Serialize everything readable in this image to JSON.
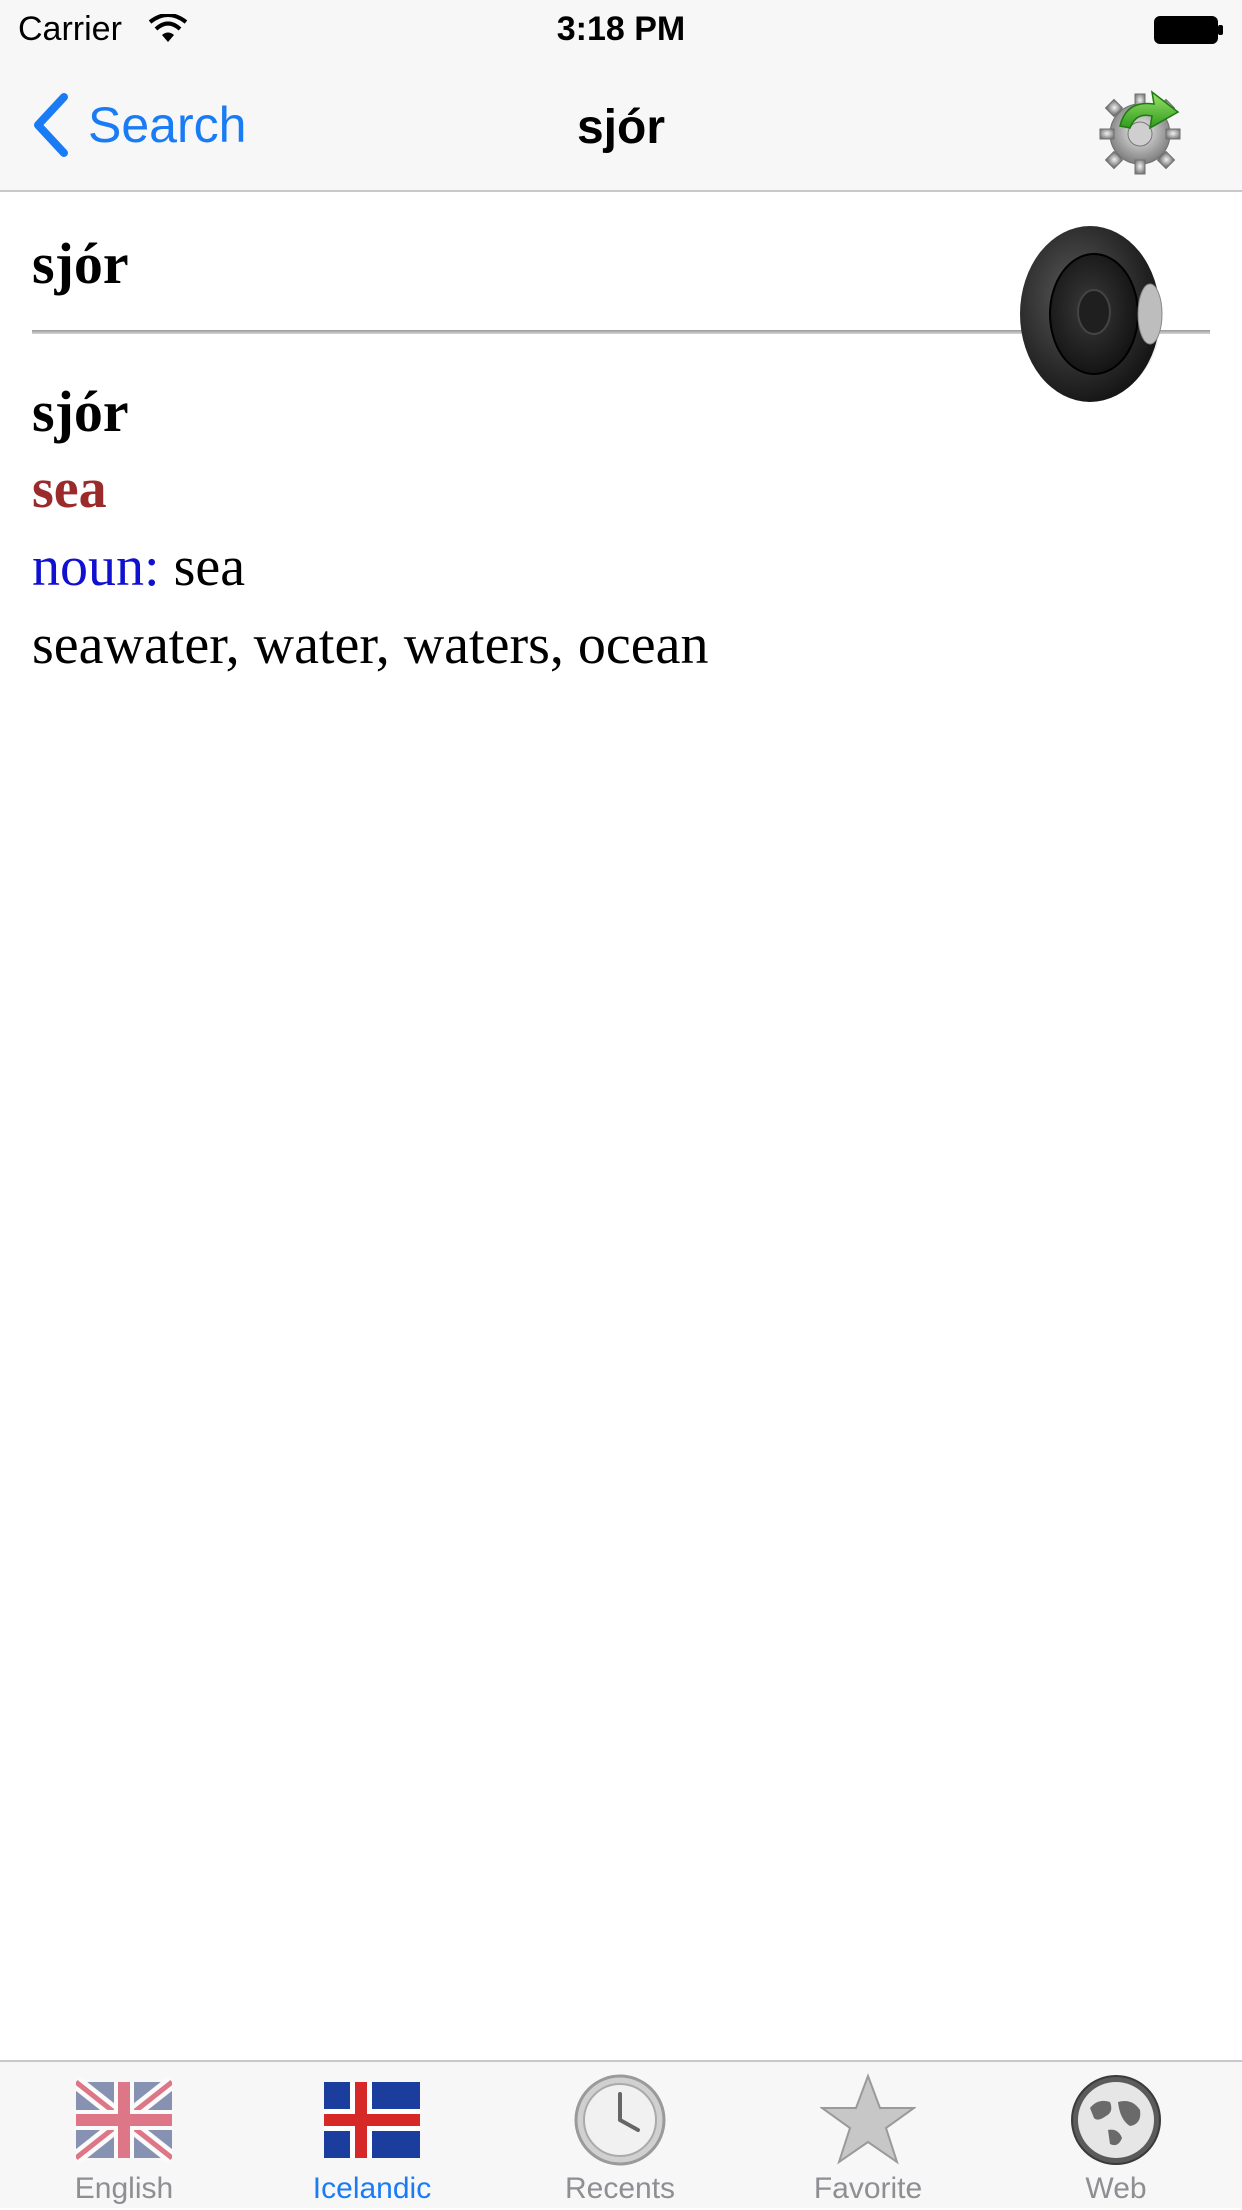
{
  "status_bar": {
    "carrier": "Carrier",
    "time": "3:18 PM"
  },
  "nav": {
    "back_label": "Search",
    "title": "sjór"
  },
  "entry": {
    "header_word": "sjór",
    "word": "sjór",
    "translation": "sea",
    "pos_label": "noun:",
    "pos_value": " sea",
    "synonyms": "seawater, water, waters, ocean"
  },
  "tabs": [
    {
      "label": "English",
      "icon": "uk-flag-icon",
      "active": false
    },
    {
      "label": "Icelandic",
      "icon": "iceland-flag-icon",
      "active": true
    },
    {
      "label": "Recents",
      "icon": "clock-icon",
      "active": false
    },
    {
      "label": "Favorite",
      "icon": "star-icon",
      "active": false
    },
    {
      "label": "Web",
      "icon": "globe-icon",
      "active": false
    }
  ],
  "colors": {
    "accent": "#1a7cf5",
    "translation": "#9b2a2a",
    "pos_label": "#1010d0"
  }
}
